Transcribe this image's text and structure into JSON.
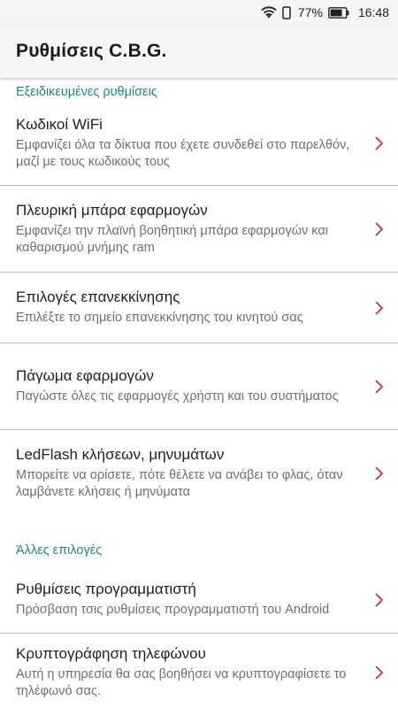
{
  "status_bar": {
    "battery_percent": "77%",
    "time": "16:48",
    "icons": [
      "wifi-icon",
      "phone-outline-icon",
      "battery-icon"
    ]
  },
  "toolbar": {
    "title": "Ρυθμίσεις C.B.G."
  },
  "sections": [
    {
      "header": "Εξειδικευμένες ρυθμίσεις",
      "items": [
        {
          "title": "Κωδικοί WiFi",
          "summary": "Εμφανίζει όλα τα δίκτυα που έχετε συνδεθεί στο παρελθόν, μαζί με τους κωδικούς τους"
        },
        {
          "title": "Πλευρική μπάρα εφαρμογών",
          "summary": "Εμφανίζει την πλαϊνή βοηθητική μπάρα εφαρμογών και καθαρισμού μνήμης ram"
        },
        {
          "title": "Επιλογές επανεκκίνησης",
          "summary": "Επιλέξτε το σημείο επανεκκίνησης του κινητού σας"
        },
        {
          "title": "Πάγωμα εφαρμογών",
          "summary": "Παγώστε όλες τις εφαρμογές χρήστη και του συστήματος"
        },
        {
          "title": "LedFlash κλήσεων, μηνυμάτων",
          "summary": "Μπορείτε να ορίσετε, πότε θέλετε να ανάβει το φλας, όταν λαμβάνετε κλήσεις ή μηνύματα"
        }
      ]
    },
    {
      "header": "Άλλες επιλογές",
      "items": [
        {
          "title": "Ρυθμίσεις προγραμματιστή",
          "summary": "Πρόσβαση τσις ρυθμίσεις προγραμματιστή του Android"
        },
        {
          "title": "Κρυπτογράφηση τηλεφώνου",
          "summary": "Αυτή η υπηρεσία θα σας βοηθήσει να κρυπτογραφίσετε το τηλέφωνό σας."
        }
      ]
    }
  ],
  "colors": {
    "accent": "#1d8a7b",
    "chevron": "#d0303f",
    "divider": "#bdbdbd"
  }
}
